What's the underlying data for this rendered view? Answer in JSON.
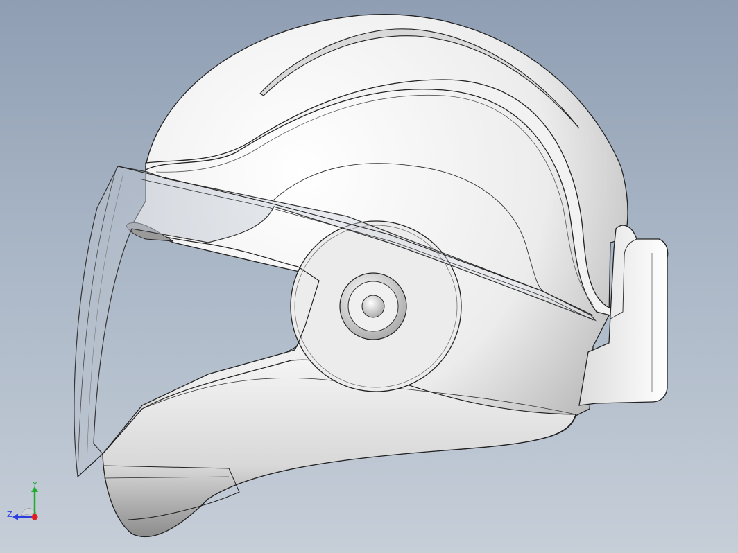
{
  "viewport": {
    "background_top": "#8f9eb3",
    "background_bottom": "#c6ced8"
  },
  "model": {
    "shell_color": "#e8e8e8",
    "edge_color": "#1a1a1a",
    "visor_tint": "#c9d0dc"
  },
  "triad": {
    "x_label": "",
    "y_label": "Y",
    "z_label": "Z",
    "y_color": "#1fae2e",
    "z_color": "#2b3de0",
    "x_color": "#e02020"
  }
}
